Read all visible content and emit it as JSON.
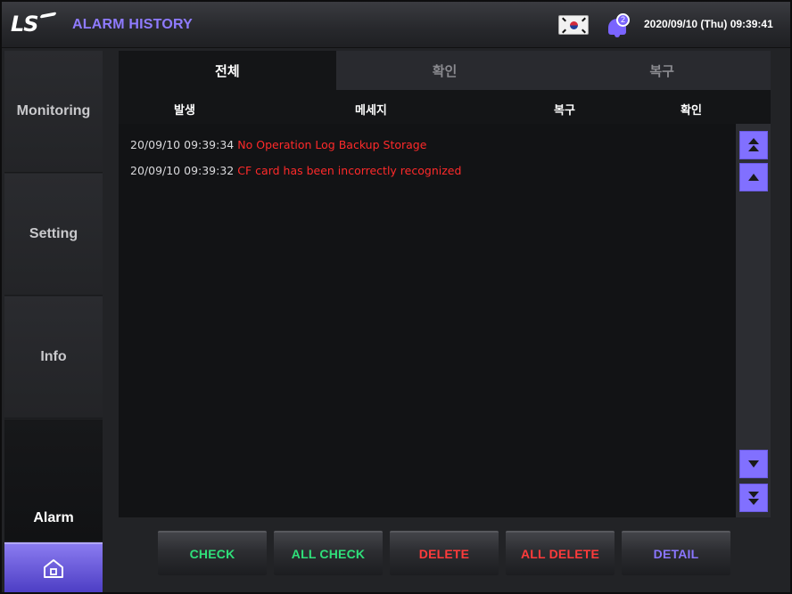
{
  "header": {
    "logo_text": "LS",
    "title": "ALARM HISTORY",
    "notification_count": "2",
    "datetime": "2020/09/10 (Thu) 09:39:41"
  },
  "sidebar": {
    "items": [
      {
        "label": "Monitoring",
        "active": false
      },
      {
        "label": "Setting",
        "active": false
      },
      {
        "label": "Info",
        "active": false
      },
      {
        "label": "Alarm",
        "active": true
      }
    ],
    "home_icon": "home-icon"
  },
  "tabs": [
    {
      "label": "전체",
      "active": true
    },
    {
      "label": "확인",
      "active": false
    },
    {
      "label": "복구",
      "active": false
    }
  ],
  "columns": {
    "occurred": "발생",
    "message": "메세지",
    "recovered": "복구",
    "confirmed": "확인"
  },
  "alarms": [
    {
      "time": "20/09/10 09:39:34",
      "message": "No Operation Log Backup Storage"
    },
    {
      "time": "20/09/10 09:39:32",
      "message": "CF card has been incorrectly recognized"
    }
  ],
  "buttons": {
    "check": "CHECK",
    "all_check": "ALL CHECK",
    "delete": "DELETE",
    "all_delete": "ALL DELETE",
    "detail": "DETAIL"
  },
  "colors": {
    "accent": "#8170ff",
    "title": "#8f7bff",
    "alarm_text": "#ff2a2a",
    "check_green": "#2fe07a",
    "delete_red": "#ff3b3b",
    "detail_purple": "#8a76ff"
  }
}
